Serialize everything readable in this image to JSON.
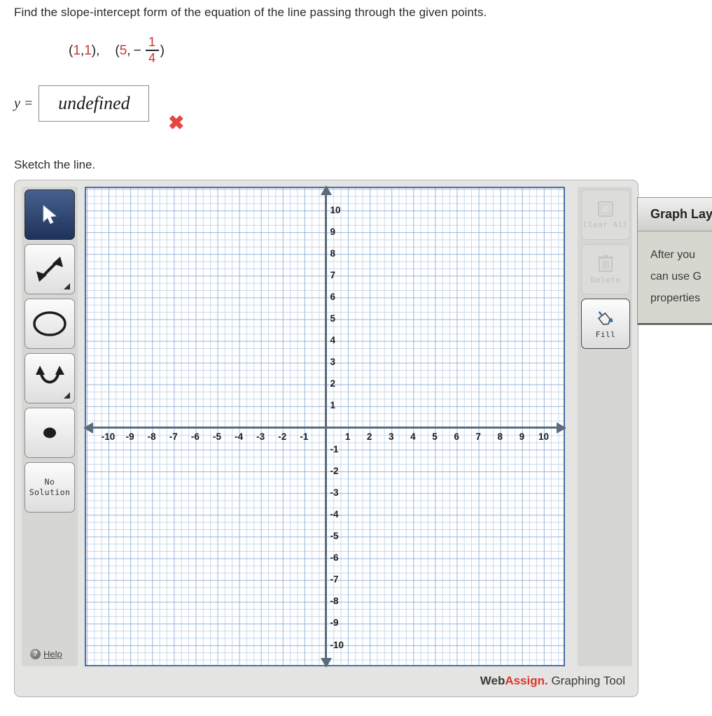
{
  "question": {
    "prompt": "Find the slope-intercept form of the equation of the line passing through the given points.",
    "point1": {
      "open": "(",
      "x": "1",
      "comma": ", ",
      "y": "1",
      "close": "),"
    },
    "point2": {
      "open": "(",
      "x": "5",
      "comma": ", ",
      "minus": "−",
      "frac_num": "1",
      "frac_den": "4",
      "close": ")"
    },
    "answer_label": "y =",
    "answer_value": "undefined",
    "answer_placeholder": "",
    "grade_mark": "✖",
    "grade_color": "#e8453c",
    "sketch_instruction": "Sketch the line."
  },
  "toolbar_left": {
    "tools": [
      {
        "name": "select-tool",
        "icon": "cursor-arrow-icon",
        "active": true,
        "has_submenu": false
      },
      {
        "name": "line-tool",
        "icon": "double-arrow-line-icon",
        "active": false,
        "has_submenu": true
      },
      {
        "name": "circle-tool",
        "icon": "circle-icon",
        "active": false,
        "has_submenu": false
      },
      {
        "name": "parabola-tool",
        "icon": "parabola-icon",
        "active": false,
        "has_submenu": true
      },
      {
        "name": "point-tool",
        "icon": "filled-dot-icon",
        "active": false,
        "has_submenu": false
      }
    ],
    "no_solution_line1": "No",
    "no_solution_line2": "Solution",
    "help_label": "Help",
    "help_icon_glyph": "?"
  },
  "toolbar_right": {
    "clear_all_label": "Clear All",
    "clear_all_enabled": false,
    "delete_label": "Delete",
    "delete_enabled": false,
    "fill_label": "Fill",
    "fill_enabled": true
  },
  "layers_panel": {
    "title": "Graph Layers",
    "body_line1": "After you",
    "body_line2": "can use G",
    "body_line3": "properties"
  },
  "footer": {
    "brand_web": "Web",
    "brand_assign": "Assign.",
    "brand_tool": " Graphing Tool",
    "brand_accent": "#e0352b"
  },
  "chart_data": {
    "type": "scatter",
    "title": "",
    "xlabel": "",
    "ylabel": "",
    "xlim": [
      -11,
      11
    ],
    "ylim": [
      -11,
      11
    ],
    "grid": true,
    "minor_grid_divisions": 3,
    "x_ticks": [
      -10,
      -9,
      -8,
      -7,
      -6,
      -5,
      -4,
      -3,
      -2,
      -1,
      1,
      2,
      3,
      4,
      5,
      6,
      7,
      8,
      9,
      10
    ],
    "y_ticks": [
      10,
      9,
      8,
      7,
      6,
      5,
      4,
      3,
      2,
      1,
      -1,
      -2,
      -3,
      -4,
      -5,
      -6,
      -7,
      -8,
      -9,
      -10
    ],
    "series": [],
    "axis_color": "#5a6b7d",
    "grid_major_color": "#7da0cd",
    "grid_minor_color": "#b4cde8",
    "border_color": "#4a6da7"
  }
}
